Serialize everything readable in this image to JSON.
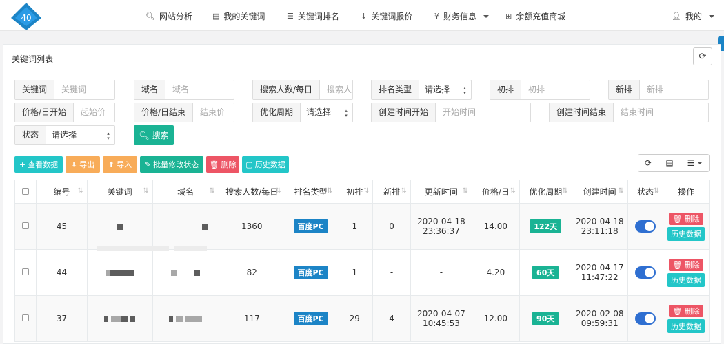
{
  "logo": {
    "text": "40",
    "color": "#1c84c6"
  },
  "nav": {
    "items": [
      {
        "icon": "search-icon",
        "glyph": "🔍︎",
        "label": "网站分析"
      },
      {
        "icon": "list-alt-icon",
        "glyph": "▤",
        "label": "我的关键词"
      },
      {
        "icon": "list-ol-icon",
        "glyph": "☰",
        "label": "关键词排名"
      },
      {
        "icon": "sort-numeric-icon",
        "glyph": "↓",
        "label": "关键词报价"
      },
      {
        "icon": "yen-icon",
        "glyph": "¥",
        "label": "财务信息"
      },
      {
        "icon": "plus-square-icon",
        "glyph": "⊞",
        "label": "余额充值商城"
      }
    ],
    "user": {
      "icon": "user-icon",
      "glyph": "👤︎",
      "label": "我的"
    }
  },
  "panel": {
    "title": "关键词列表",
    "refresh_glyph": "⟳"
  },
  "form": {
    "keyword": {
      "label": "关键词",
      "placeholder": "关键词"
    },
    "domain": {
      "label": "域名",
      "placeholder": "域名"
    },
    "search_volume": {
      "label": "搜索人数/每日",
      "placeholder": "搜索人"
    },
    "rank_type": {
      "label": "排名类型",
      "value": "请选择"
    },
    "init_rank": {
      "label": "初排",
      "placeholder": "初排"
    },
    "new_rank": {
      "label": "新排",
      "placeholder": "新排"
    },
    "price_start": {
      "label": "价格/日开始",
      "placeholder": "起始价"
    },
    "price_end": {
      "label": "价格/日结束",
      "placeholder": "结束价"
    },
    "period": {
      "label": "优化周期",
      "value": "请选择"
    },
    "created_start": {
      "label": "创建时间开始",
      "placeholder": "开始时间"
    },
    "created_end": {
      "label": "创建时间结束",
      "placeholder": "结束时间"
    },
    "status": {
      "label": "状态",
      "value": "请选择"
    },
    "search_button": "搜索"
  },
  "toolbar": {
    "view": "查看数据",
    "export": "导出",
    "import": "导入",
    "batch": "批量修改状态",
    "delete": "删除",
    "history": "历史数据"
  },
  "table": {
    "headers": [
      "编号",
      "关键词",
      "域名",
      "搜索人数/每日",
      "排名类型",
      "初排",
      "新排",
      "更新时间",
      "价格/日",
      "优化周期",
      "创建时间",
      "状态",
      "操作"
    ],
    "rows": [
      {
        "id": "45",
        "volume": "1360",
        "rank_type": "百度PC",
        "init": "1",
        "new": "0",
        "updated_date": "2020-04-18",
        "updated_time": "23:36:37",
        "price": "14.00",
        "period": "122天",
        "created_date": "2020-04-18",
        "created_time": "23:11:18",
        "delete": "删除",
        "history": "历史数据"
      },
      {
        "id": "44",
        "volume": "82",
        "rank_type": "百度PC",
        "init": "1",
        "new": "-",
        "updated_date": "-",
        "updated_time": "",
        "price": "4.20",
        "period": "60天",
        "created_date": "2020-04-17",
        "created_time": "11:47:22",
        "delete": "删除",
        "history": "历史数据"
      },
      {
        "id": "37",
        "volume": "117",
        "rank_type": "百度PC",
        "init": "29",
        "new": "4",
        "updated_date": "2020-04-07",
        "updated_time": "10:45:53",
        "price": "12.00",
        "period": "90天",
        "created_date": "2020-02-08",
        "created_time": "09:59:31",
        "delete": "删除",
        "history": "历史数据"
      }
    ]
  }
}
